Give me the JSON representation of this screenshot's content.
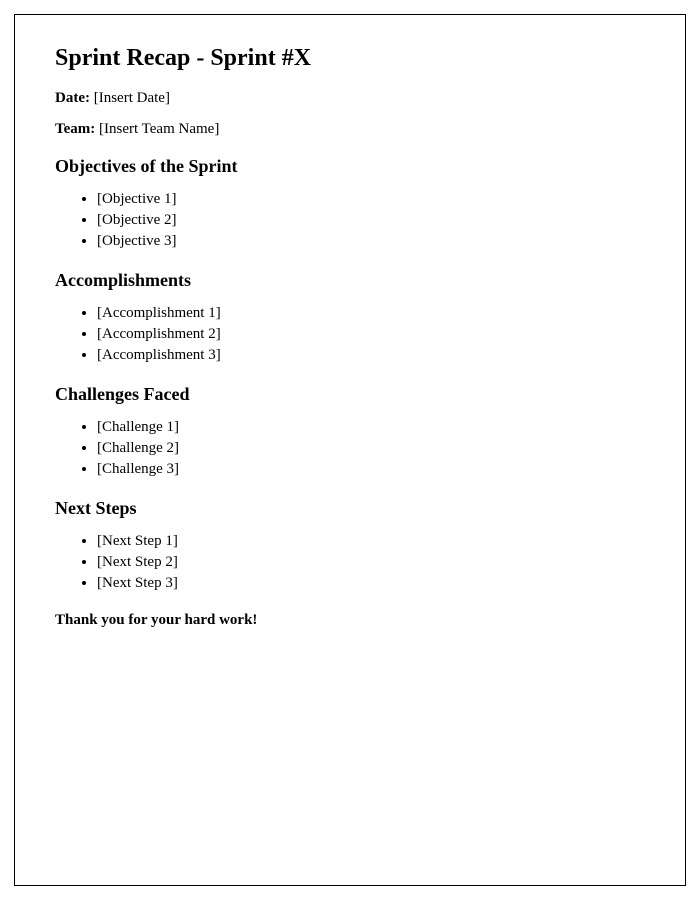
{
  "title": "Sprint Recap - Sprint #X",
  "meta": {
    "date_label": "Date:",
    "date_value": "[Insert Date]",
    "team_label": "Team:",
    "team_value": "[Insert Team Name]"
  },
  "sections": {
    "objectives": {
      "heading": "Objectives of the Sprint",
      "items": [
        "[Objective 1]",
        "[Objective 2]",
        "[Objective 3]"
      ]
    },
    "accomplishments": {
      "heading": "Accomplishments",
      "items": [
        "[Accomplishment 1]",
        "[Accomplishment 2]",
        "[Accomplishment 3]"
      ]
    },
    "challenges": {
      "heading": "Challenges Faced",
      "items": [
        "[Challenge 1]",
        "[Challenge 2]",
        "[Challenge 3]"
      ]
    },
    "next_steps": {
      "heading": "Next Steps",
      "items": [
        "[Next Step 1]",
        "[Next Step 2]",
        "[Next Step 3]"
      ]
    }
  },
  "closing": "Thank you for your hard work!"
}
